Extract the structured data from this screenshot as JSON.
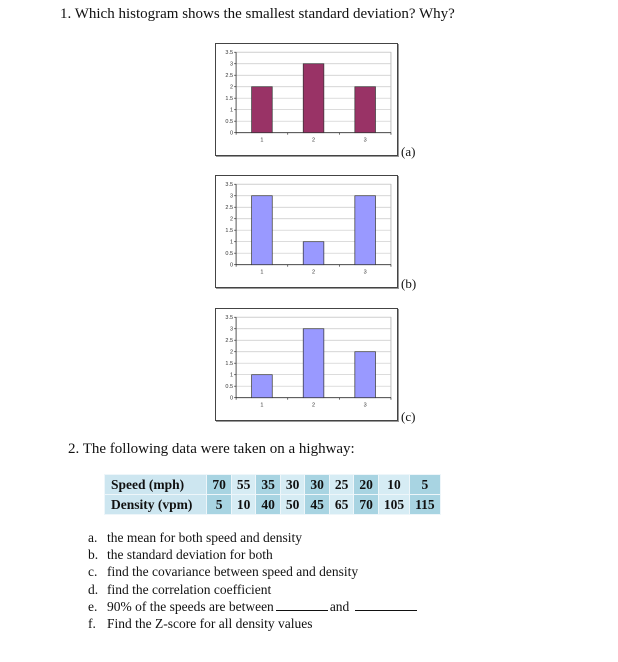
{
  "question1": {
    "text": "1. Which histogram shows the smallest standard deviation? Why?"
  },
  "chart_data": [
    {
      "type": "bar",
      "label": "(a)",
      "categories": [
        "1",
        "2",
        "3"
      ],
      "values": [
        2,
        3,
        2
      ],
      "ylim": [
        0,
        3.5
      ],
      "yticks": [
        "0",
        "0.5",
        "1",
        "1.5",
        "2",
        "2.5",
        "3",
        "3.5"
      ],
      "grid": true,
      "bar_color": "#993366",
      "title": "",
      "xlabel": "",
      "ylabel": ""
    },
    {
      "type": "bar",
      "label": "(b)",
      "categories": [
        "1",
        "2",
        "3"
      ],
      "values": [
        3,
        1,
        3
      ],
      "ylim": [
        0,
        3.5
      ],
      "yticks": [
        "0",
        "0.5",
        "1",
        "1.5",
        "2",
        "2.5",
        "3",
        "3.5"
      ],
      "grid": true,
      "bar_color": "#9999ff",
      "title": "",
      "xlabel": "",
      "ylabel": ""
    },
    {
      "type": "bar",
      "label": "(c)",
      "categories": [
        "1",
        "2",
        "3"
      ],
      "values": [
        1,
        3,
        2
      ],
      "ylim": [
        0,
        3.5
      ],
      "yticks": [
        "0",
        "0.5",
        "1",
        "1.5",
        "2",
        "2.5",
        "3",
        "3.5"
      ],
      "grid": true,
      "bar_color": "#9999ff",
      "title": "",
      "xlabel": "",
      "ylabel": ""
    }
  ],
  "question2": {
    "text": "2. The following data were taken on a highway:",
    "table": {
      "rows": [
        {
          "header": "Speed (mph)",
          "values": [
            "70",
            "55",
            "35",
            "30",
            "30",
            "25",
            "20",
            "10",
            "5"
          ]
        },
        {
          "header": "Density (vpm)",
          "values": [
            "5",
            "10",
            "40",
            "50",
            "45",
            "65",
            "70",
            "105",
            "115"
          ]
        }
      ],
      "colors": {
        "header_bg": "#cde6f0",
        "dark_col_bg": "#a8d4e2",
        "light_col_bg": "#d6ecf4"
      }
    },
    "items": [
      {
        "label": "a.",
        "text": "the mean for both speed and density"
      },
      {
        "label": "b.",
        "text": "the standard deviation for both"
      },
      {
        "label": "c.",
        "text": "find the covariance between speed and density"
      },
      {
        "label": "d.",
        "text": "find the correlation coefficient"
      },
      {
        "label": "e.",
        "text_before": "90% of the speeds are between",
        "text_middle": "and"
      },
      {
        "label": "f.",
        "text": "Find the Z-score for all density values"
      }
    ]
  }
}
